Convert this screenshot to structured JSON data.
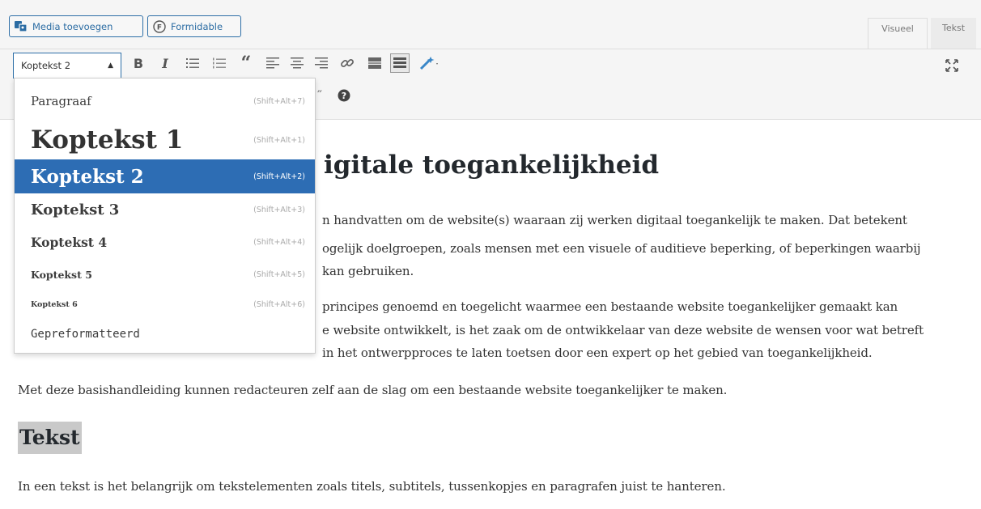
{
  "toolbar_top": {
    "media_button": "Media toevoegen",
    "formidable_button": "Formidable",
    "tab_visual": "Visueel",
    "tab_text": "Tekst"
  },
  "format_select": {
    "current": "Koptekst 2"
  },
  "format_options": [
    {
      "label": "Paragraaf",
      "shortcut": "(Shift+Alt+7)",
      "selected": false
    },
    {
      "label": "Koptekst 1",
      "shortcut": "(Shift+Alt+1)",
      "selected": false
    },
    {
      "label": "Koptekst 2",
      "shortcut": "(Shift+Alt+2)",
      "selected": true
    },
    {
      "label": "Koptekst 3",
      "shortcut": "(Shift+Alt+3)",
      "selected": false
    },
    {
      "label": "Koptekst 4",
      "shortcut": "(Shift+Alt+4)",
      "selected": false
    },
    {
      "label": "Koptekst 5",
      "shortcut": "(Shift+Alt+5)",
      "selected": false
    },
    {
      "label": "Koptekst 6",
      "shortcut": "(Shift+Alt+6)",
      "selected": false
    },
    {
      "label": "Gepreformatteerd",
      "shortcut": "",
      "selected": false
    }
  ],
  "icons": {
    "bold": "B",
    "italic": "I",
    "blockquote": "“",
    "help": "?"
  },
  "content": {
    "heading_visible": "igitale toegankelijkheid",
    "p1_line1": "n handvatten om de website(s) waaraan zij werken digitaal toegankelijk te maken. Dat betekent",
    "p1_line2": "ogelijk doelgroepen, zoals mensen met een visuele of auditieve beperking, of beperkingen waarbij",
    "p1_line3": "kan gebruiken.",
    "p2_line1": "principes genoemd en toegelicht waarmee een bestaande website toegankelijker gemaakt kan",
    "p2_line2": "e website ontwikkelt, is het zaak om de ontwikkelaar van deze website de wensen voor wat betreft",
    "p2_line3": "in het ontwerpproces te laten toetsen door een expert op het gebied van toegankelijkheid.",
    "p3": "Met deze basishandleiding kunnen redacteuren zelf aan de slag om een bestaande website toegankelijker te maken.",
    "heading_tekst": "Tekst",
    "p4": "In een tekst is het belangrijk om tekstelementen zoals titels, subtitels, tussenkopjes en paragrafen juist te hanteren."
  }
}
